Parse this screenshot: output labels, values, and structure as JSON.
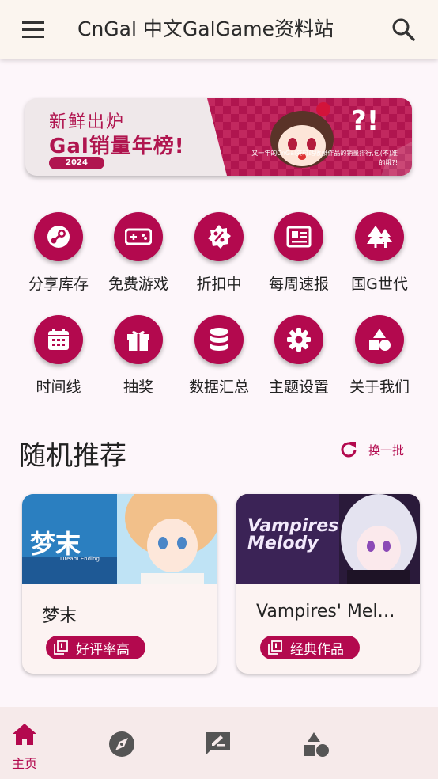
{
  "app": {
    "title": "CnGal 中文GalGame资料站"
  },
  "icons": {
    "menu": "menu-icon",
    "search": "search-icon"
  },
  "banner": {
    "line1": "新鲜出炉",
    "line2": "Gal销量年榜!",
    "year": "2024",
    "caption": "又一年的CnGal资料站收录作品的销量排行,包(不)准的哦?!"
  },
  "quick_links": [
    {
      "label": "分享库存",
      "icon": "steam-icon"
    },
    {
      "label": "免费游戏",
      "icon": "gamepad-icon"
    },
    {
      "label": "折扣中",
      "icon": "discount-icon"
    },
    {
      "label": "每周速报",
      "icon": "newspaper-icon"
    },
    {
      "label": "国G世代",
      "icon": "trees-icon"
    },
    {
      "label": "时间线",
      "icon": "calendar-icon"
    },
    {
      "label": "抽奖",
      "icon": "gift-icon"
    },
    {
      "label": "数据汇总",
      "icon": "database-icon"
    },
    {
      "label": "主题设置",
      "icon": "gear-icon"
    },
    {
      "label": "关于我们",
      "icon": "shapes-icon"
    }
  ],
  "recommend": {
    "title": "随机推荐",
    "refresh_label": "换一批",
    "cards": [
      {
        "name": "梦末",
        "tag": "好评率高",
        "cover_title": "梦末",
        "cover_subtitle": "Dream Ending"
      },
      {
        "name": "Vampires' Mel…",
        "tag": "经典作品",
        "cover_title": "Vampires Melody"
      }
    ]
  },
  "bottom_nav": [
    {
      "label": "主页",
      "icon": "home-icon",
      "active": true
    },
    {
      "label": "",
      "icon": "compass-icon",
      "active": false
    },
    {
      "label": "",
      "icon": "edit-note-icon",
      "active": false
    },
    {
      "label": "",
      "icon": "shapes-icon",
      "active": false
    }
  ],
  "colors": {
    "accent": "#b3094e",
    "background": "#fdf6fa",
    "topbar": "#fbf5ef"
  }
}
